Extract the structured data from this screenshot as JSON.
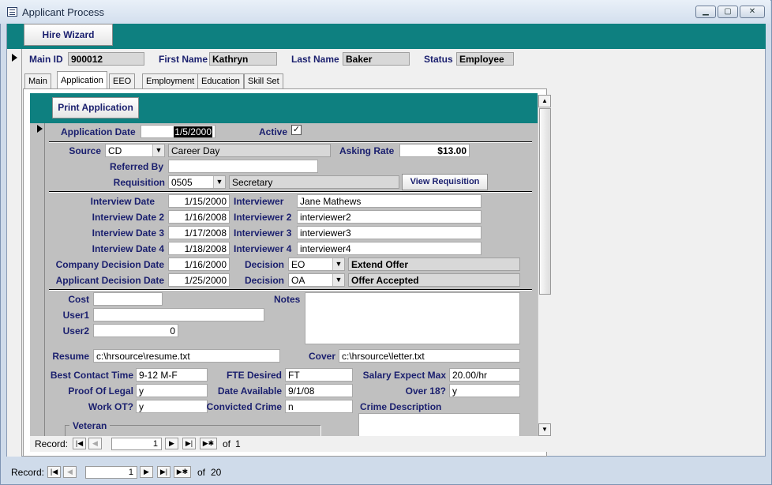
{
  "window": {
    "title": "Applicant Process",
    "minimize": "▁",
    "maximize": "▢",
    "close": "✕"
  },
  "toolbar": {
    "hire_wizard": "Hire Wizard"
  },
  "header": {
    "main_id_label": "Main ID",
    "main_id": "900012",
    "first_name_label": "First Name",
    "first_name": "Kathryn",
    "last_name_label": "Last Name",
    "last_name": "Baker",
    "status_label": "Status",
    "status": "Employee"
  },
  "tabs": [
    {
      "label": "Main"
    },
    {
      "label": "Application"
    },
    {
      "label": "EEO"
    },
    {
      "label": "Employment"
    },
    {
      "label": "Education"
    },
    {
      "label": "Skill Set"
    }
  ],
  "application": {
    "print_button": "Print Application",
    "application_date_label": "Application Date",
    "application_date": "1/5/2000",
    "active_label": "Active",
    "active_check": "✓",
    "source_label": "Source",
    "source_code": "CD",
    "source_desc": "Career Day",
    "asking_rate_label": "Asking Rate",
    "asking_rate": "$13.00",
    "referred_by_label": "Referred By",
    "referred_by": "",
    "requisition_label": "Requisition",
    "requisition_code": "0505",
    "requisition_desc": "Secretary",
    "view_requisition": "View Requisition",
    "interviews": [
      {
        "label": "Interview Date",
        "date": "1/15/2000",
        "iv_label": "Interviewer",
        "interviewer": "Jane Mathews"
      },
      {
        "label": "Interview Date 2",
        "date": "1/16/2008",
        "iv_label": "Interviewer 2",
        "interviewer": "interviewer2"
      },
      {
        "label": "Interview Date 3",
        "date": "1/17/2008",
        "iv_label": "Interviewer 3",
        "interviewer": "interviewer3"
      },
      {
        "label": "Interview Date 4",
        "date": "1/18/2008",
        "iv_label": "Interviewer 4",
        "interviewer": "interviewer4"
      }
    ],
    "company_decision_label": "Company Decision Date",
    "company_decision_date": "1/16/2000",
    "decision_label": "Decision",
    "company_decision_code": "EO",
    "company_decision_desc": "Extend Offer",
    "applicant_decision_label": "Applicant Decision Date",
    "applicant_decision_date": "1/25/2000",
    "applicant_decision_code": "OA",
    "applicant_decision_desc": "Offer Accepted",
    "cost_label": "Cost",
    "cost": "",
    "user1_label": "User1",
    "user1": "",
    "user2_label": "User2",
    "user2": "0",
    "notes_label": "Notes",
    "notes": "",
    "resume_label": "Resume",
    "resume": "c:\\hrsource\\resume.txt",
    "cover_label": "Cover",
    "cover": "c:\\hrsource\\letter.txt",
    "best_contact_label": "Best Contact Time",
    "best_contact": "9-12 M-F",
    "fte_label": "FTE Desired",
    "fte": "FT",
    "salary_label": "Salary Expect Max",
    "salary": "20.00/hr",
    "proof_label": "Proof Of Legal",
    "proof": "y",
    "date_avail_label": "Date Available",
    "date_avail": "9/1/08",
    "over18_label": "Over 18?",
    "over18": "y",
    "work_ot_label": "Work OT?",
    "work_ot": "y",
    "convicted_label": "Convicted Crime",
    "convicted": "n",
    "crime_desc_label": "Crime Description",
    "crime_desc": "",
    "veteran_label": "Veteran"
  },
  "subnav": {
    "label": "Record:",
    "current": "1",
    "of": "of",
    "total": "1"
  },
  "mainnav": {
    "label": "Record:",
    "current": "1",
    "of": "of",
    "total": "20"
  }
}
